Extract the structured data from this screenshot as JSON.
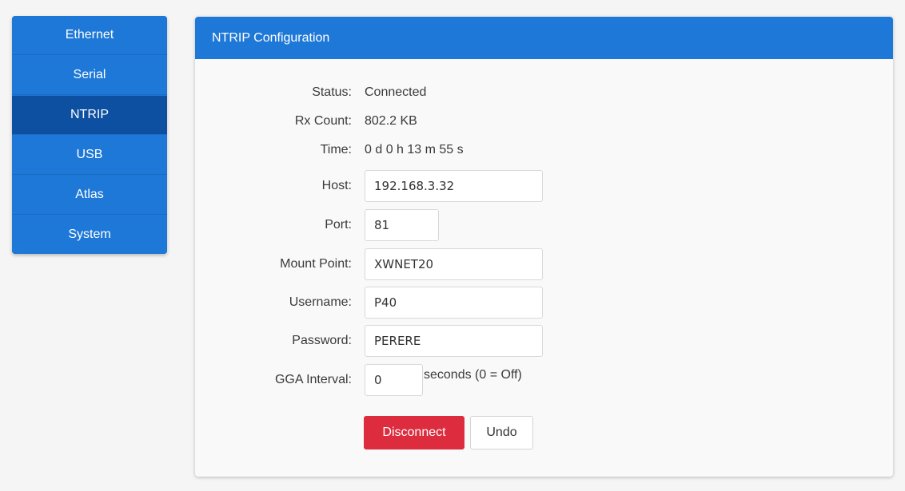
{
  "sidebar": {
    "items": [
      {
        "label": "Ethernet",
        "active": false
      },
      {
        "label": "Serial",
        "active": false
      },
      {
        "label": "NTRIP",
        "active": true
      },
      {
        "label": "USB",
        "active": false
      },
      {
        "label": "Atlas",
        "active": false
      },
      {
        "label": "System",
        "active": false
      }
    ]
  },
  "panel": {
    "title": "NTRIP Configuration",
    "status": {
      "label": "Status:",
      "value": "Connected"
    },
    "rx_count": {
      "label": "Rx Count:",
      "value": "802.2 KB"
    },
    "time": {
      "label": "Time:",
      "value": "0 d 0 h 13 m 55 s"
    },
    "host": {
      "label": "Host:",
      "value": "192.168.3.32"
    },
    "port": {
      "label": "Port:",
      "value": "81"
    },
    "mount_point": {
      "label": "Mount Point:",
      "value": "XWNET20"
    },
    "username": {
      "label": "Username:",
      "value": "P40"
    },
    "password": {
      "label": "Password:",
      "value": "PERERE"
    },
    "gga_interval": {
      "label": "GGA Interval:",
      "value": "0",
      "suffix": "seconds (0 = Off)"
    },
    "buttons": {
      "disconnect": "Disconnect",
      "undo": "Undo"
    }
  },
  "colors": {
    "primary": "#1e78d7",
    "active_nav": "#0d4fa1",
    "danger": "#dc2c3e",
    "background": "#f5f5f5"
  }
}
